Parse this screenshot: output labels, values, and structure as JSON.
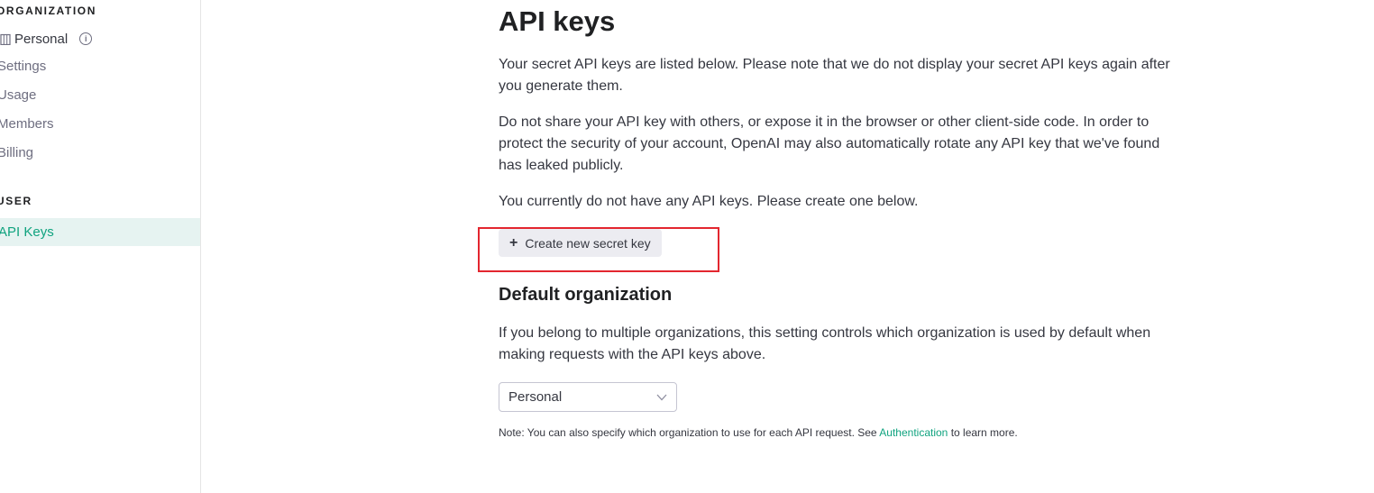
{
  "sidebar": {
    "organization_title": "ORGANIZATION",
    "org_name": "Personal",
    "org_items": [
      {
        "label": "Settings"
      },
      {
        "label": "Usage"
      },
      {
        "label": "Members"
      },
      {
        "label": "Billing"
      }
    ],
    "user_title": "USER",
    "user_items": [
      {
        "label": "API Keys",
        "active": true
      }
    ]
  },
  "main": {
    "title": "API keys",
    "intro": "Your secret API keys are listed below. Please note that we do not display your secret API keys again after you generate them.",
    "warning": "Do not share your API key with others, or expose it in the browser or other client-side code. In order to protect the security of your account, OpenAI may also automatically rotate any API key that we've found has leaked publicly.",
    "empty_state": "You currently do not have any API keys. Please create one below.",
    "create_button": "Create new secret key",
    "default_org_heading": "Default organization",
    "default_org_description": "If you belong to multiple organizations, this setting controls which organization is used by default when making requests with the API keys above.",
    "org_select_value": "Personal",
    "note_prefix": "Note: You can also specify which organization to use for each API request. See",
    "note_link": "Authentication",
    "note_suffix": "to learn more."
  },
  "colors": {
    "accent": "#10a37f",
    "active_bg": "#e6f3f1",
    "highlight_border": "#e3262f"
  }
}
